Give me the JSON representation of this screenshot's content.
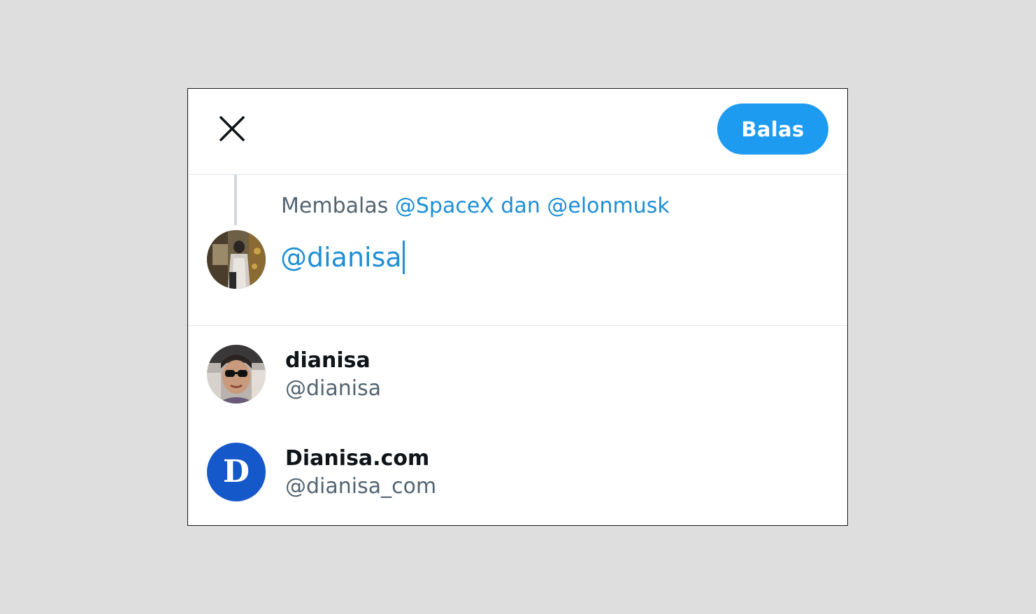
{
  "header": {
    "close_icon": "close-icon",
    "reply_label": "Balas"
  },
  "compose": {
    "replying_prefix": "Membalas",
    "replying_mentions": "@SpaceX dan @elonmusk",
    "text": "@dianisa"
  },
  "suggestions": [
    {
      "name": "dianisa",
      "handle": "@dianisa"
    },
    {
      "name": "Dianisa.com",
      "handle": "@dianisa_com",
      "avatar_letter": "D"
    }
  ],
  "colors": {
    "accent": "#1d9bf0",
    "mention": "#1d8fd6",
    "secondary_text": "#536471",
    "primary_text": "#0f1419"
  }
}
